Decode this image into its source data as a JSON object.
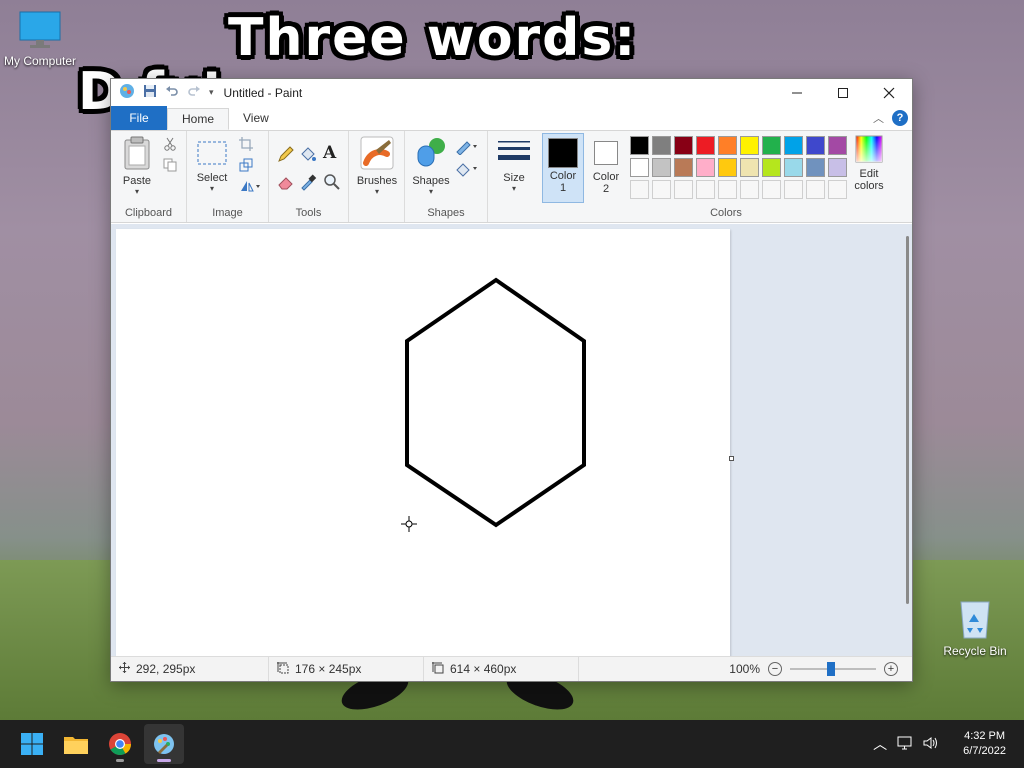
{
  "desktop": {
    "meme_line1": "Three words:",
    "meme_line2": "D             fy!",
    "icons": {
      "my_computer": "My Computer",
      "recycle_bin": "Recycle Bin"
    }
  },
  "window": {
    "title": "Untitled - Paint",
    "tabs": {
      "file": "File",
      "home": "Home",
      "view": "View"
    },
    "ribbon": {
      "clipboard": {
        "paste": "Paste",
        "label": "Clipboard"
      },
      "image": {
        "select": "Select",
        "label": "Image"
      },
      "tools": {
        "label": "Tools"
      },
      "brushes": {
        "label": "Brushes"
      },
      "shapes": {
        "shapes": "Shapes",
        "label": "Shapes"
      },
      "size": {
        "label": "Size"
      },
      "colors": {
        "color1": "Color\n1",
        "color2": "Color\n2",
        "edit_colors": "Edit\ncolors",
        "label": "Colors",
        "color1_value": "#000000",
        "color2_value": "#ffffff",
        "palette_row1": [
          "#000000",
          "#7f7f7f",
          "#880015",
          "#ed1c24",
          "#ff7f27",
          "#fff200",
          "#22b14c",
          "#00a2e8",
          "#3f48cc",
          "#a349a4"
        ],
        "palette_row2": [
          "#ffffff",
          "#c3c3c3",
          "#b97a57",
          "#ffaec9",
          "#ffc90e",
          "#efe4b0",
          "#b5e61d",
          "#99d9ea",
          "#7092be",
          "#c8bfe7"
        ]
      }
    },
    "status": {
      "cursor_pos": "292, 295px",
      "selection_size": "176 × 245px",
      "image_size": "614 × 460px",
      "zoom": "100%"
    }
  },
  "taskbar": {
    "time": "4:32 PM",
    "date": "6/7/2022"
  }
}
